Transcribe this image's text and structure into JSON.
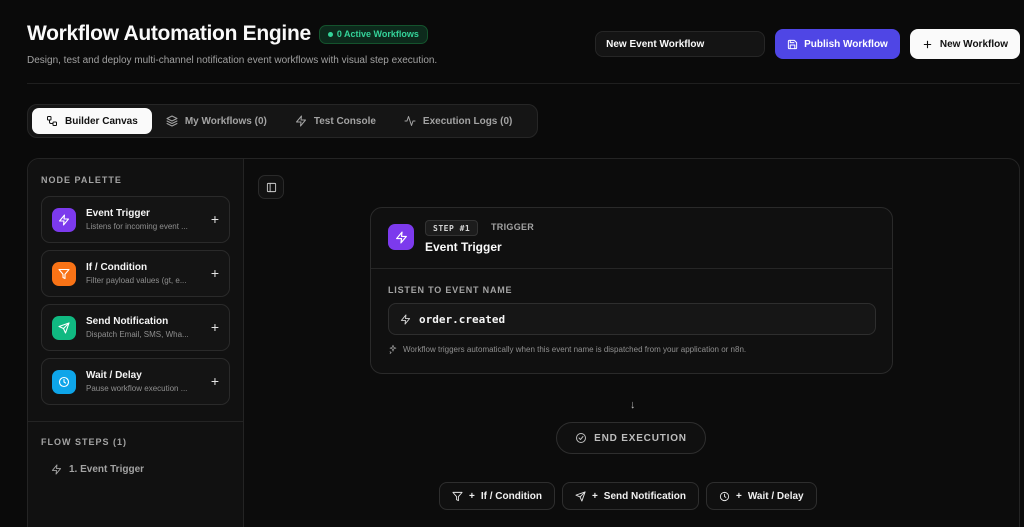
{
  "header": {
    "title": "Workflow Automation Engine",
    "badge": "0 Active Workflows",
    "subtitle": "Design, test and deploy multi-channel notification event workflows with visual step execution.",
    "workflow_name_value": "New Event Workflow",
    "publish_label": "Publish Workflow",
    "new_label": "New Workflow"
  },
  "tabs": [
    {
      "label": "Builder Canvas",
      "icon": "nodes-icon",
      "active": true
    },
    {
      "label": "My Workflows (0)",
      "icon": "layers-icon"
    },
    {
      "label": "Test Console",
      "icon": "bolt-icon"
    },
    {
      "label": "Execution Logs (0)",
      "icon": "activity-icon"
    }
  ],
  "sidebar": {
    "palette_label": "NODE PALETTE",
    "palette": [
      {
        "title": "Event Trigger",
        "desc": "Listens for incoming event ...",
        "icon": "bolt-icon",
        "color": "#7c3aed"
      },
      {
        "title": "If / Condition",
        "desc": "Filter payload values (gt, e...",
        "icon": "filter-icon",
        "color": "#f97316"
      },
      {
        "title": "Send Notification",
        "desc": "Dispatch Email, SMS, Wha...",
        "icon": "send-icon",
        "color": "#10b981"
      },
      {
        "title": "Wait / Delay",
        "desc": "Pause workflow execution ...",
        "icon": "clock-icon",
        "color": "#0ea5e9"
      }
    ],
    "flow_label": "FLOW STEPS (1)",
    "flow_steps": [
      "1. Event Trigger"
    ]
  },
  "canvas": {
    "node": {
      "step": "STEP #1",
      "type": "TRIGGER",
      "title": "Event Trigger",
      "listen_label": "LISTEN TO EVENT NAME",
      "event_name": "order.created",
      "hint": "Workflow triggers automatically when this event name is dispatched from your application or n8n."
    },
    "end_label": "END EXECUTION",
    "add_buttons": [
      "If / Condition",
      "Send Notification",
      "Wait / Delay"
    ]
  },
  "colors": {
    "accent": "#4f46e5",
    "trigger": "#7c3aed",
    "condition": "#f97316",
    "notification": "#10b981",
    "wait": "#0ea5e9",
    "badge_green": "#34d399"
  }
}
